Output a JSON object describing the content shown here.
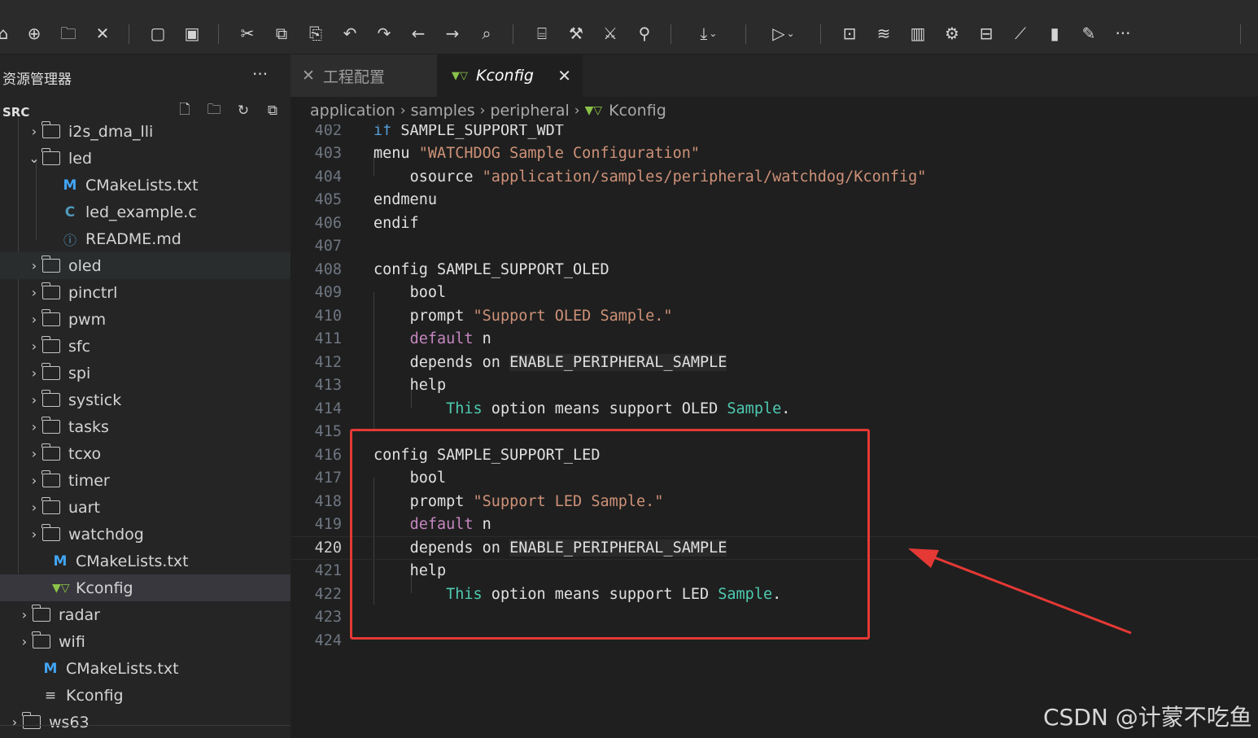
{
  "toolbar": {
    "icons": [
      "open-icon",
      "new-file-icon",
      "open-folder-icon",
      "tools-icon",
      "stop-icon",
      "save-icon",
      "cut-icon",
      "copy-icon",
      "paste-icon",
      "undo-icon",
      "redo-icon",
      "back-icon",
      "forward-icon",
      "search-icon",
      "build-icon",
      "hammer-icon",
      "rebuild-icon",
      "clean-icon",
      "download-icon",
      "debug-icon",
      "terminal-icon",
      "layers-icon",
      "stats-icon",
      "chip-icon",
      "monitor-icon",
      "chart-icon",
      "flash-icon",
      "edit-icon",
      "more-icon"
    ]
  },
  "sidebar": {
    "title": "资源管理器",
    "more": "···",
    "section": "SRC",
    "tree": [
      {
        "label": "i2s_dma_lli",
        "type": "folder",
        "state": "collapsed"
      },
      {
        "label": "led",
        "type": "folder",
        "state": "expanded"
      },
      {
        "label": "CMakeLists.txt",
        "type": "cmake"
      },
      {
        "label": "led_example.c",
        "type": "c"
      },
      {
        "label": "README.md",
        "type": "info"
      },
      {
        "label": "oled",
        "type": "folder",
        "state": "collapsed"
      },
      {
        "label": "pinctrl",
        "type": "folder",
        "state": "collapsed"
      },
      {
        "label": "pwm",
        "type": "folder",
        "state": "collapsed"
      },
      {
        "label": "sfc",
        "type": "folder",
        "state": "collapsed"
      },
      {
        "label": "spi",
        "type": "folder",
        "state": "collapsed"
      },
      {
        "label": "systick",
        "type": "folder",
        "state": "collapsed"
      },
      {
        "label": "tasks",
        "type": "folder",
        "state": "collapsed"
      },
      {
        "label": "tcxo",
        "type": "folder",
        "state": "collapsed"
      },
      {
        "label": "timer",
        "type": "folder",
        "state": "collapsed"
      },
      {
        "label": "uart",
        "type": "folder",
        "state": "collapsed"
      },
      {
        "label": "watchdog",
        "type": "folder",
        "state": "collapsed"
      },
      {
        "label": "CMakeLists.txt",
        "type": "cmake"
      },
      {
        "label": "Kconfig",
        "type": "kconfig",
        "selected": true
      },
      {
        "label": "radar",
        "type": "folder",
        "state": "collapsed"
      },
      {
        "label": "wifi",
        "type": "folder",
        "state": "collapsed"
      },
      {
        "label": "CMakeLists.txt",
        "type": "cmake"
      },
      {
        "label": "Kconfig",
        "type": "text"
      },
      {
        "label": "ws63",
        "type": "folder",
        "state": "collapsed"
      }
    ]
  },
  "tabs": [
    {
      "label": "工程配置",
      "active": false
    },
    {
      "label": "Kconfig",
      "active": true,
      "close": "✕"
    }
  ],
  "breadcrumb": [
    "application",
    "samples",
    "peripheral",
    "Kconfig"
  ],
  "editor": {
    "current_line": "420",
    "lines": [
      {
        "n": "402"
      },
      {
        "n": "403"
      },
      {
        "n": "404"
      },
      {
        "n": "405"
      },
      {
        "n": "406"
      },
      {
        "n": "407"
      },
      {
        "n": "408"
      },
      {
        "n": "409"
      },
      {
        "n": "410"
      },
      {
        "n": "411"
      },
      {
        "n": "412"
      },
      {
        "n": "413"
      },
      {
        "n": "414"
      },
      {
        "n": "415"
      },
      {
        "n": "416"
      },
      {
        "n": "417"
      },
      {
        "n": "418"
      },
      {
        "n": "419"
      },
      {
        "n": "420"
      },
      {
        "n": "421"
      },
      {
        "n": "422"
      },
      {
        "n": "423"
      },
      {
        "n": "424"
      }
    ],
    "tokens": {
      "if": "if",
      "wdt": "SAMPLE_SUPPORT_WDT",
      "menu": "menu",
      "menu_str": "\"WATCHDOG Sample Configuration\"",
      "osource": "osource",
      "osource_str": "\"application/samples/peripheral/watchdog/Kconfig\"",
      "endmenu": "endmenu",
      "endif": "endif",
      "config": "config",
      "oled": "SAMPLE_SUPPORT_OLED",
      "bool": "bool",
      "prompt": "prompt",
      "oled_str": "\"Support OLED Sample.\"",
      "default": "default",
      "n": "n",
      "depends_on": "depends on",
      "dep": "ENABLE_PERIPHERAL_SAMPLE",
      "help": "help",
      "this": "This",
      "oled_help_mid": " option means support OLED ",
      "sample": "Sample",
      "dot": ".",
      "led": "SAMPLE_SUPPORT_LED",
      "led_str": "\"Support LED Sample.\"",
      "led_help_mid": " option means support LED "
    }
  },
  "watermark": "CSDN @计蒙不吃鱼",
  "colors": {
    "highlight_box": "#e53935",
    "arrow": "#e53935"
  }
}
